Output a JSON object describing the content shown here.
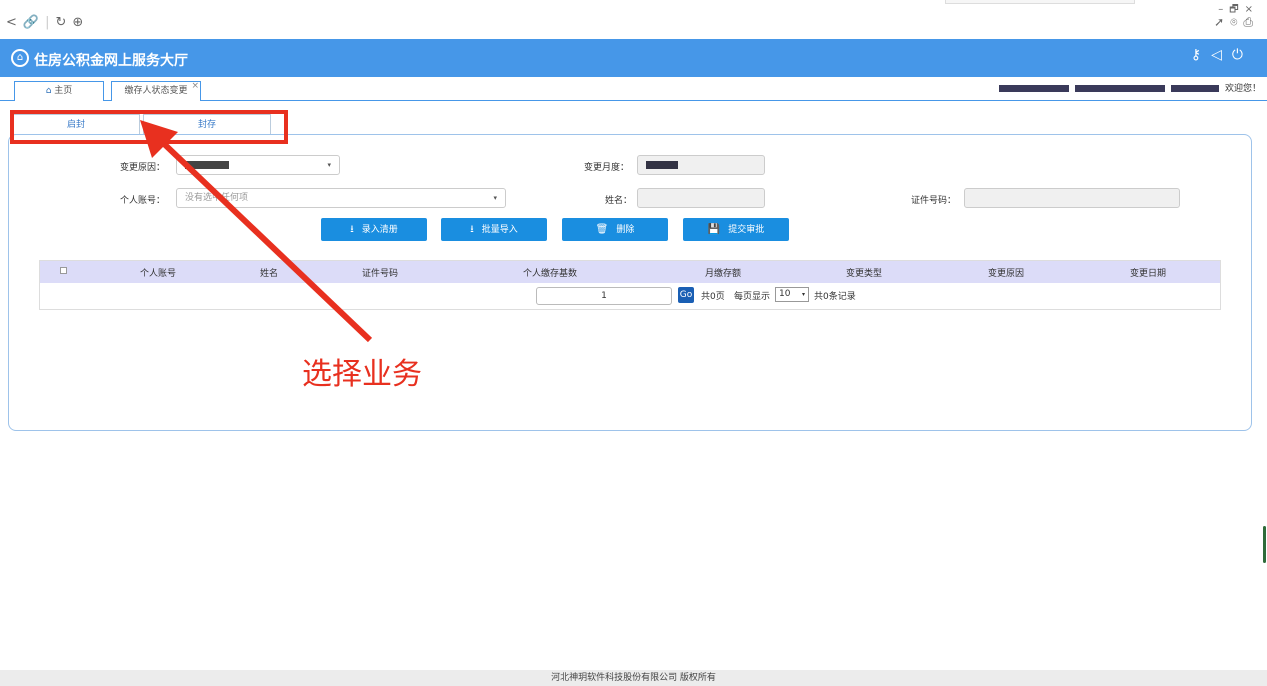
{
  "browser": {
    "back": "<",
    "link": "🔗",
    "divider": "|",
    "refresh": "↻",
    "globe": "⊕",
    "min": "–",
    "max": "🗗",
    "close": "×",
    "share": "➚",
    "shield": "⌾",
    "ext": "⎙"
  },
  "header": {
    "logo": "⌂",
    "title": "住房公积金网上服务大厅",
    "icon_key": "⚷",
    "icon_sound": "◁",
    "icon_power": "⏻"
  },
  "tabs": {
    "home_icon": "⌂",
    "home_label": "主页",
    "active_label": "缴存人状态变更",
    "close": "×",
    "welcome": "欢迎您！"
  },
  "subtabs": {
    "open": "启封",
    "seal": "封存"
  },
  "form": {
    "change_type_label": "变更原因：",
    "change_month_label": "变更月度：",
    "account_label": "个人账号：",
    "account_placeholder": "没有选中任何项",
    "name_label": "姓名：",
    "id_label": "证件号码：",
    "caret": "▾"
  },
  "buttons": {
    "enter": "录入清册",
    "batch": "批量导入",
    "delete": "删除",
    "submit": "提交审批",
    "enter_icon": "⭳",
    "batch_icon": "⭳",
    "delete_icon": "🗑",
    "submit_icon": "💾"
  },
  "grid": {
    "columns": [
      "个人账号",
      "姓名",
      "证件号码",
      "个人缴存基数",
      "月缴存额",
      "变更类型",
      "变更原因",
      "变更日期"
    ]
  },
  "pager": {
    "page": "1",
    "go": "Go",
    "total_pages": "共0页",
    "per_page": "每页显示",
    "page_size": "10",
    "total_records": "共0条记录"
  },
  "annotation": {
    "text": "选择业务",
    "color": "#e8301f"
  },
  "footer": {
    "text": "河北神玥软件科技股份有限公司 版权所有"
  },
  "colors": {
    "header": "#4697e8",
    "button": "#1a8ee0",
    "grid_header": "#dcdcf8"
  }
}
